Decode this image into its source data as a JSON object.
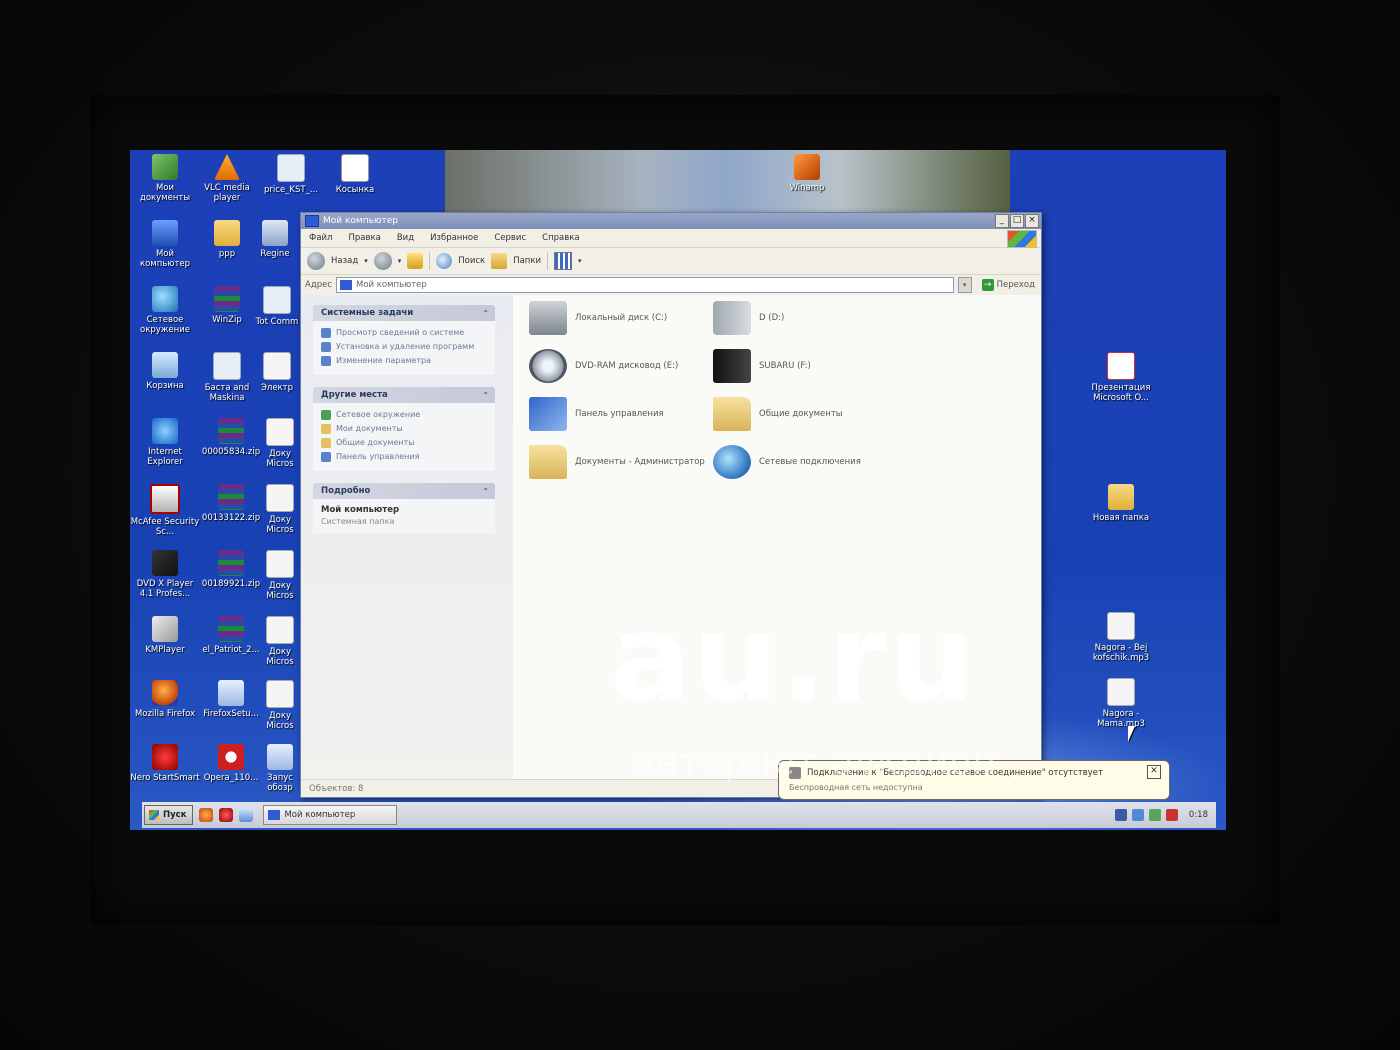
{
  "desktop": {
    "left_icons": [
      {
        "label": "Мои документы",
        "icon": "my-documents-icon"
      },
      {
        "label": "VLC media player",
        "icon": "vlc-icon"
      },
      {
        "label": "price_KST_...",
        "icon": "spreadsheet-file-icon"
      },
      {
        "label": "Косынка",
        "icon": "solitaire-icon"
      },
      {
        "label": "Мой компьютер",
        "icon": "my-computer-icon"
      },
      {
        "label": "ppp",
        "icon": "folder-icon"
      },
      {
        "label": "Regine",
        "icon": "registry-file-icon"
      },
      {
        "label": "Сетевое окружение",
        "icon": "network-places-icon"
      },
      {
        "label": "WinZip",
        "icon": "winzip-icon"
      },
      {
        "label": "Tot Comm",
        "icon": "total-commander-icon"
      },
      {
        "label": "Корзина",
        "icon": "recycle-bin-icon"
      },
      {
        "label": "Баста and Maskina",
        "icon": "media-file-icon"
      },
      {
        "label": "Электр",
        "icon": "document-icon"
      },
      {
        "label": "Internet Explorer",
        "icon": "internet-explorer-icon"
      },
      {
        "label": "00005834.zip",
        "icon": "zip-archive-icon"
      },
      {
        "label": "Доку Micros",
        "icon": "document-icon"
      },
      {
        "label": "McAfee Security Sc...",
        "icon": "mcafee-icon"
      },
      {
        "label": "00133122.zip",
        "icon": "zip-archive-icon"
      },
      {
        "label": "Доку Micros",
        "icon": "document-icon"
      },
      {
        "label": "DVD X Player 4.1 Profes...",
        "icon": "dvd-player-icon"
      },
      {
        "label": "00189921.zip",
        "icon": "zip-archive-icon"
      },
      {
        "label": "Доку Micros",
        "icon": "document-icon"
      },
      {
        "label": "KMPlayer",
        "icon": "kmplayer-icon"
      },
      {
        "label": "el_Patriot_2...",
        "icon": "zip-archive-icon"
      },
      {
        "label": "Доку Micros",
        "icon": "document-icon"
      },
      {
        "label": "Mozilla Firefox",
        "icon": "firefox-icon"
      },
      {
        "label": "FirefoxSetu...",
        "icon": "installer-icon"
      },
      {
        "label": "Доку Micros",
        "icon": "document-icon"
      },
      {
        "label": "Nero StartSmart",
        "icon": "nero-icon"
      },
      {
        "label": "Opera_110...",
        "icon": "opera-icon"
      },
      {
        "label": "Запус обозр",
        "icon": "shortcut-icon"
      }
    ],
    "right_icons": [
      {
        "label": "Winamp",
        "icon": "winamp-icon"
      },
      {
        "label": "Презентация Microsoft O...",
        "icon": "powerpoint-icon"
      },
      {
        "label": "Новая папка",
        "icon": "folder-icon"
      },
      {
        "label": "Nagora - Bej kofschik.mp3",
        "icon": "audio-file-icon"
      },
      {
        "label": "Nagora - Mama.mp3",
        "icon": "audio-file-icon"
      }
    ]
  },
  "window": {
    "title": "Мой компьютер",
    "menu": [
      "Файл",
      "Правка",
      "Вид",
      "Избранное",
      "Сервис",
      "Справка"
    ],
    "toolbar": {
      "back": "Назад",
      "search": "Поиск",
      "folders": "Папки"
    },
    "address": {
      "label": "Адрес",
      "value": "Мой компьютер",
      "go": "Переход"
    },
    "panels": [
      {
        "title": "Системные задачи",
        "items": [
          "Просмотр сведений о системе",
          "Установка и удаление программ",
          "Изменение параметра"
        ]
      },
      {
        "title": "Другие места",
        "items": [
          "Сетевое окружение",
          "Мои документы",
          "Общие документы",
          "Панель управления"
        ]
      }
    ],
    "details": {
      "title": "Подробно",
      "name": "Мой компьютер",
      "sub": "Системная папка"
    },
    "items": [
      {
        "label": "Локальный диск (C:)",
        "icon": "hard-disk-icon"
      },
      {
        "label": "D (D:)",
        "icon": "usb-modem-icon"
      },
      {
        "label": "DVD-RAM дисковод (E:)",
        "icon": "dvd-drive-icon"
      },
      {
        "label": "SUBARU (F:)",
        "icon": "usb-flash-drive-icon"
      },
      {
        "label": "Панель управления",
        "icon": "control-panel-icon"
      },
      {
        "label": "Общие документы",
        "icon": "folder-icon"
      },
      {
        "label": "Документы - Администратор",
        "icon": "folder-icon"
      },
      {
        "label": "Сетевые подключения",
        "icon": "network-connections-icon"
      }
    ],
    "status": "Объектов: 8"
  },
  "balloon": {
    "title": "Подключение к \"Беспроводное сетевое соединение\" отсутствует",
    "body": "Беспроводная сеть недоступна",
    "close": "✕"
  },
  "taskbar": {
    "start": "Пуск",
    "task": "Мой компьютер",
    "clock": "0:18"
  },
  "watermark": {
    "main": "au.ru",
    "sub": "интернет-аукцион"
  }
}
